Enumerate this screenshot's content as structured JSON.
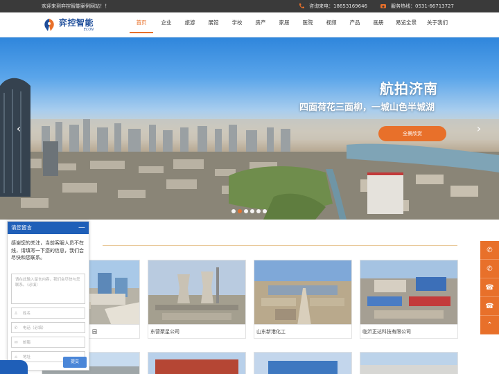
{
  "topbar": {
    "welcome": "欢迎来到弈控智能案例网站！！",
    "consult_label": "咨询来电：18653169646",
    "hotline_label": "服务热线：0531-66713727"
  },
  "header": {
    "logo_cn": "弈控智能",
    "logo_en": "ECON",
    "nav": [
      {
        "label": "首页",
        "active": true
      },
      {
        "label": "企业"
      },
      {
        "label": "旅游"
      },
      {
        "label": "展馆"
      },
      {
        "label": "学校"
      },
      {
        "label": "房产"
      },
      {
        "label": "家居"
      },
      {
        "label": "医院"
      },
      {
        "label": "视频"
      },
      {
        "label": "产品"
      },
      {
        "label": "画册"
      },
      {
        "label": "易览全景"
      },
      {
        "label": "关于我们"
      }
    ]
  },
  "banner": {
    "title": "航拍济南",
    "subtitle": "四面荷花三面柳，一城山色半城湖",
    "button": "全景欣赏",
    "prev_icon": "‹",
    "next_icon": "›",
    "dot_count": 6,
    "active_dot": 1
  },
  "cases": [
    {
      "caption": "园"
    },
    {
      "caption": "东营聚星公司"
    },
    {
      "caption": "山东新港化工"
    },
    {
      "caption": "临沂正达科技有限公司"
    }
  ],
  "chat": {
    "title": "请您留言",
    "minimize": "—",
    "message": "感谢您的关注，当前客服人员不在线，请填写一下您的信息，我们会尽快和您联系。",
    "textarea_placeholder": "请在此输入留言内容，我们会尽快与您联系。（必填）",
    "fields": [
      {
        "icon": "♙",
        "placeholder": "姓名"
      },
      {
        "icon": "✆",
        "placeholder": "电话（必填）"
      },
      {
        "icon": "✉",
        "placeholder": "邮箱"
      },
      {
        "icon": "⌂",
        "placeholder": "地址"
      }
    ],
    "submit": "提交"
  },
  "sidebar": {
    "items": [
      {
        "icon": "✆",
        "name": "phone-icon"
      },
      {
        "icon": "✆",
        "name": "phone-icon"
      },
      {
        "icon": "☎",
        "name": "telephone-icon"
      },
      {
        "icon": "☎",
        "name": "telephone-icon"
      },
      {
        "icon": "⌃",
        "name": "back-to-top-icon"
      }
    ]
  },
  "colors": {
    "accent": "#e8702a",
    "brand_blue": "#1f4e9a",
    "chat_blue": "#1f5fb8",
    "topbar_bg": "#3a3a3a"
  }
}
